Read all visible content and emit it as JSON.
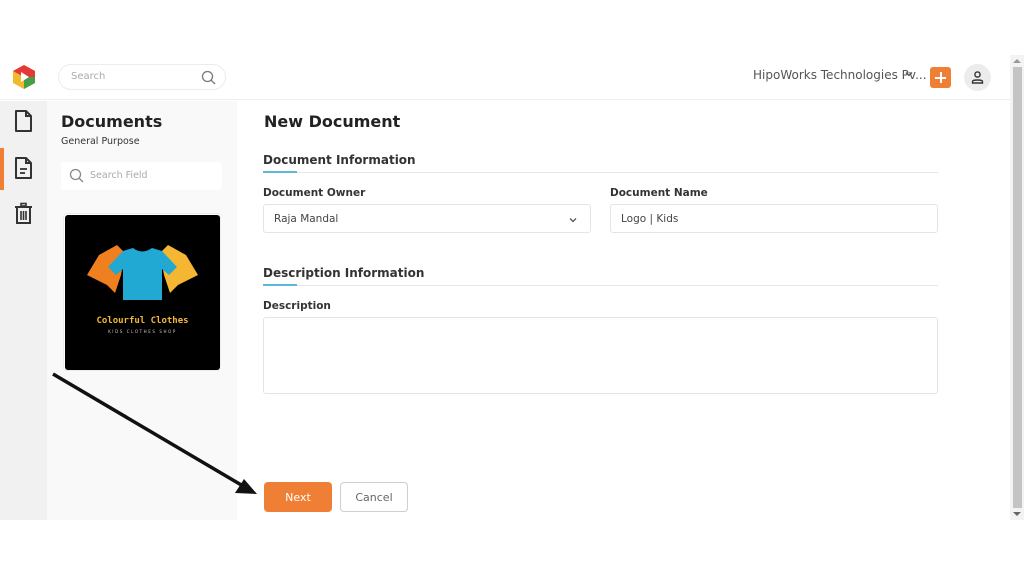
{
  "topbar": {
    "search_placeholder": "Search",
    "company_name": "HipoWorks Technologies Pv...",
    "add_label": "+",
    "colors": {
      "accent": "#f07f36"
    }
  },
  "rail": {
    "items": [
      {
        "name": "documents",
        "icon": "file-icon",
        "active": false
      },
      {
        "name": "general-purpose",
        "icon": "file-text-icon",
        "active": true
      },
      {
        "name": "trash",
        "icon": "trash-icon",
        "active": false
      }
    ]
  },
  "panel": {
    "title": "Documents",
    "subtitle": "General Purpose",
    "search_placeholder": "Search Field",
    "thumbnail": {
      "title": "Colourful Clothes",
      "tagline": "KIDS CLOTHES SHOP"
    }
  },
  "main": {
    "title": "New Document",
    "sections": {
      "document_info": "Document Information",
      "description_info": "Description Information"
    },
    "fields": {
      "owner_label": "Document Owner",
      "owner_value": "Raja Mandal",
      "name_label": "Document Name",
      "name_value": "Logo | Kids",
      "description_label": "Description",
      "description_value": ""
    },
    "buttons": {
      "next": "Next",
      "cancel": "Cancel"
    }
  }
}
